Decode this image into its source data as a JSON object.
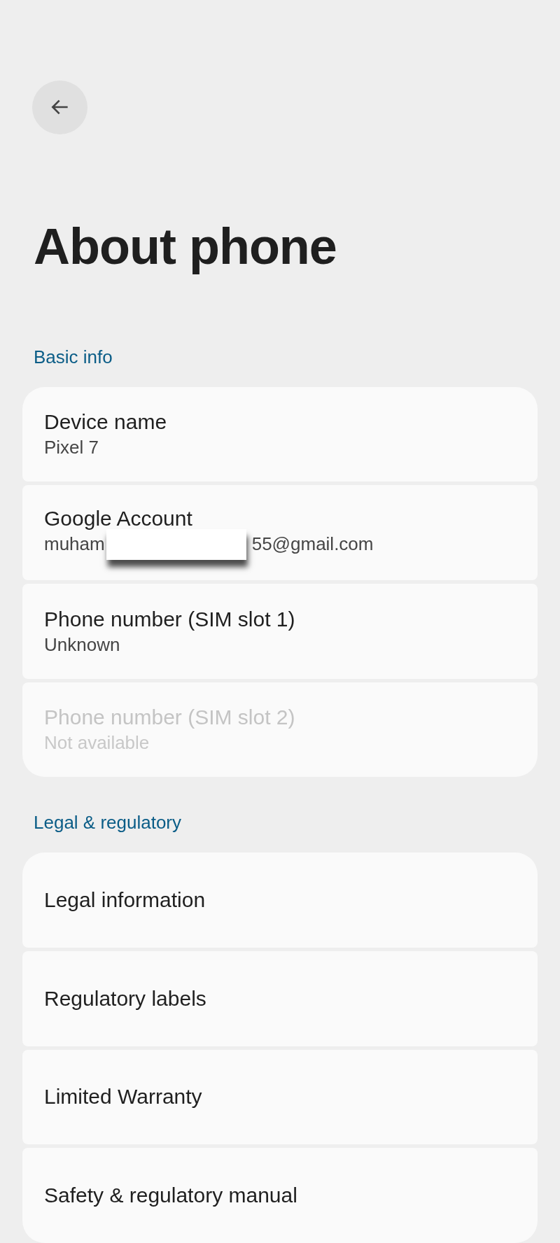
{
  "header": {
    "title": "About phone"
  },
  "sections": [
    {
      "heading": "Basic info",
      "items": [
        {
          "kind": "detail",
          "title": "Device name",
          "subtitle": "Pixel 7",
          "disabled": false
        },
        {
          "kind": "redacted",
          "title": "Google Account",
          "subtitle_start": "muham",
          "subtitle_end": "55@gmail.com",
          "disabled": false
        },
        {
          "kind": "detail",
          "title": "Phone number (SIM slot 1)",
          "subtitle": "Unknown",
          "disabled": false
        },
        {
          "kind": "detail",
          "title": "Phone number (SIM slot 2)",
          "subtitle": "Not available",
          "disabled": true
        }
      ]
    },
    {
      "heading": "Legal & regulatory",
      "items": [
        {
          "kind": "link",
          "title": "Legal information",
          "disabled": false
        },
        {
          "kind": "link",
          "title": "Regulatory labels",
          "disabled": false
        },
        {
          "kind": "link",
          "title": "Limited Warranty",
          "disabled": false
        },
        {
          "kind": "link",
          "title": "Safety & regulatory manual",
          "disabled": false
        }
      ]
    }
  ]
}
